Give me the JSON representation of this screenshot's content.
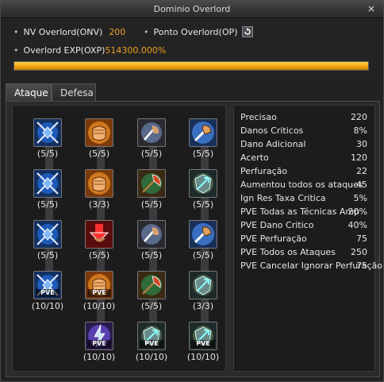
{
  "window": {
    "title": "Dominio Overlord",
    "close_label": "×"
  },
  "header": {
    "nv_label": "NV Overlord(ONV)",
    "nv_value": "200",
    "op_label": "Ponto Overlord(OP)",
    "op_value": "0",
    "exp_label": "Overlord EXP(OXP)",
    "exp_value": "514300.000%",
    "exp_fill_fraction": 1.0,
    "reset_icon": "reset-icon"
  },
  "tabs": [
    {
      "label": "Ataque",
      "active": true
    },
    {
      "label": "Defesa",
      "active": false
    }
  ],
  "skills": [
    {
      "icon": "sword-gem-icon",
      "count": "(5/5)",
      "pve": ""
    },
    {
      "icon": "fist-icon",
      "count": "(5/5)",
      "pve": ""
    },
    {
      "icon": "strike-icon",
      "count": "(5/5)",
      "pve": ""
    },
    {
      "icon": "fist-blue-icon",
      "count": "(5/5)",
      "pve": ""
    },
    {
      "icon": "sword-gem-icon",
      "count": "(5/5)",
      "pve": ""
    },
    {
      "icon": "fist-icon",
      "count": "(3/3)",
      "pve": ""
    },
    {
      "icon": "axe-icon",
      "count": "(5/5)",
      "pve": ""
    },
    {
      "icon": "shield-arrow-icon",
      "count": "(5/5)",
      "pve": ""
    },
    {
      "icon": "sword-gem-icon",
      "count": "(5/5)",
      "pve": ""
    },
    {
      "icon": "arrow-down-icon",
      "count": "(5/5)",
      "pve": ""
    },
    {
      "icon": "strike-icon",
      "count": "(5/5)",
      "pve": ""
    },
    {
      "icon": "fist-blue-icon",
      "count": "(5/5)",
      "pve": ""
    },
    {
      "icon": "sword-gem-icon",
      "count": "(10/10)",
      "pve": "PVE"
    },
    {
      "icon": "fist-icon",
      "count": "(10/10)",
      "pve": "PVE"
    },
    {
      "icon": "axe-icon",
      "count": "(5/5)",
      "pve": ""
    },
    {
      "icon": "shield-arrow-icon",
      "count": "(3/3)",
      "pve": ""
    },
    {
      "icon": "lightning-icon",
      "count": "(10/10)",
      "pve": "PVE"
    },
    {
      "icon": "shield-arrow-icon",
      "count": "(10/10)",
      "pve": "PVE"
    },
    {
      "icon": "shield-arrow-icon",
      "count": "(10/10)",
      "pve": "PVE"
    }
  ],
  "stats": [
    {
      "name": "Precisao",
      "value": "220"
    },
    {
      "name": "Danos Criticos",
      "value": "8%"
    },
    {
      "name": "Dano Adicional",
      "value": "30"
    },
    {
      "name": "Acerto",
      "value": "120"
    },
    {
      "name": "Perfuração",
      "value": "22"
    },
    {
      "name": "Aumentou todos os ataques",
      "value": "45"
    },
    {
      "name": "Ign Res Taxa Critica",
      "value": "5%"
    },
    {
      "name": "PVE Todas as Técnicas Amp",
      "value": "20%"
    },
    {
      "name": "PVE Dano Critico",
      "value": "40%"
    },
    {
      "name": "PVE Perfuração",
      "value": "75"
    },
    {
      "name": "PVE Todos os Ataques",
      "value": "250"
    },
    {
      "name": "PVE Cancelar Ignorar Perfuração",
      "value": "75"
    }
  ],
  "colors": {
    "accent": "#f0a020",
    "exp_bar": "#f2a512",
    "panel": "#1c1c1d"
  }
}
